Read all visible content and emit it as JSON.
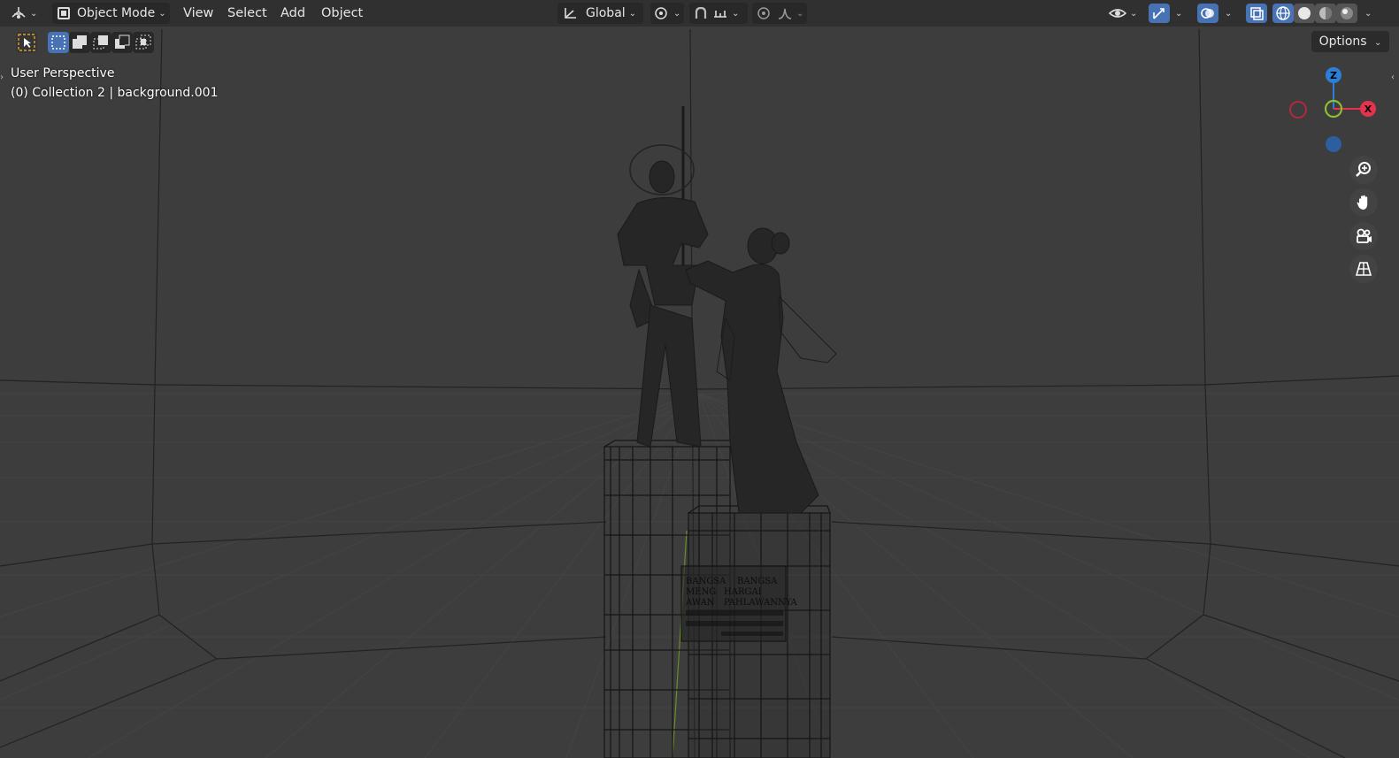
{
  "header": {
    "editor_type_icon": "editor-type-icon",
    "mode": {
      "label": "Object Mode",
      "icon": "object-mode-icon"
    },
    "menus": [
      "View",
      "Select",
      "Add",
      "Object"
    ],
    "transform_orientation": "Global",
    "pivot_icon": "pivot-point-icon",
    "snap_icon": "snap-icon",
    "proportional_icon": "proportional-edit-icon",
    "visibility_icon": "eye-icon",
    "gizmo_icon": "gizmo-icon",
    "overlay_icon": "overlay-icon",
    "xray_icon": "xray-icon",
    "shading_modes": [
      "wireframe",
      "solid",
      "material-preview",
      "rendered"
    ]
  },
  "toolbar_row": {
    "select_tool_icon": "select-cursor-icon",
    "selection_modes": [
      "set",
      "extend",
      "subtract",
      "invert",
      "intersect"
    ],
    "options_label": "Options"
  },
  "viewport": {
    "view_name": "User Perspective",
    "collection_info": "(0) Collection 2 | background.001",
    "plaque_text": [
      "BANGSA",
      "BANGSA",
      "MENG",
      "HARGAI",
      "AWAN",
      "PAHLAWANNYA"
    ]
  },
  "navigation": {
    "axes": {
      "z": "Z",
      "x": "X"
    },
    "buttons": [
      "zoom-icon",
      "hand-pan-icon",
      "camera-icon",
      "grid-view-icon"
    ]
  },
  "colors": {
    "header_bg": "#303030",
    "viewport_bg": "#3d3d3d",
    "accent_blue": "#4772b3",
    "axis_x": "#e5334e",
    "axis_y": "#8bbf30",
    "axis_z": "#2d7ed6"
  }
}
